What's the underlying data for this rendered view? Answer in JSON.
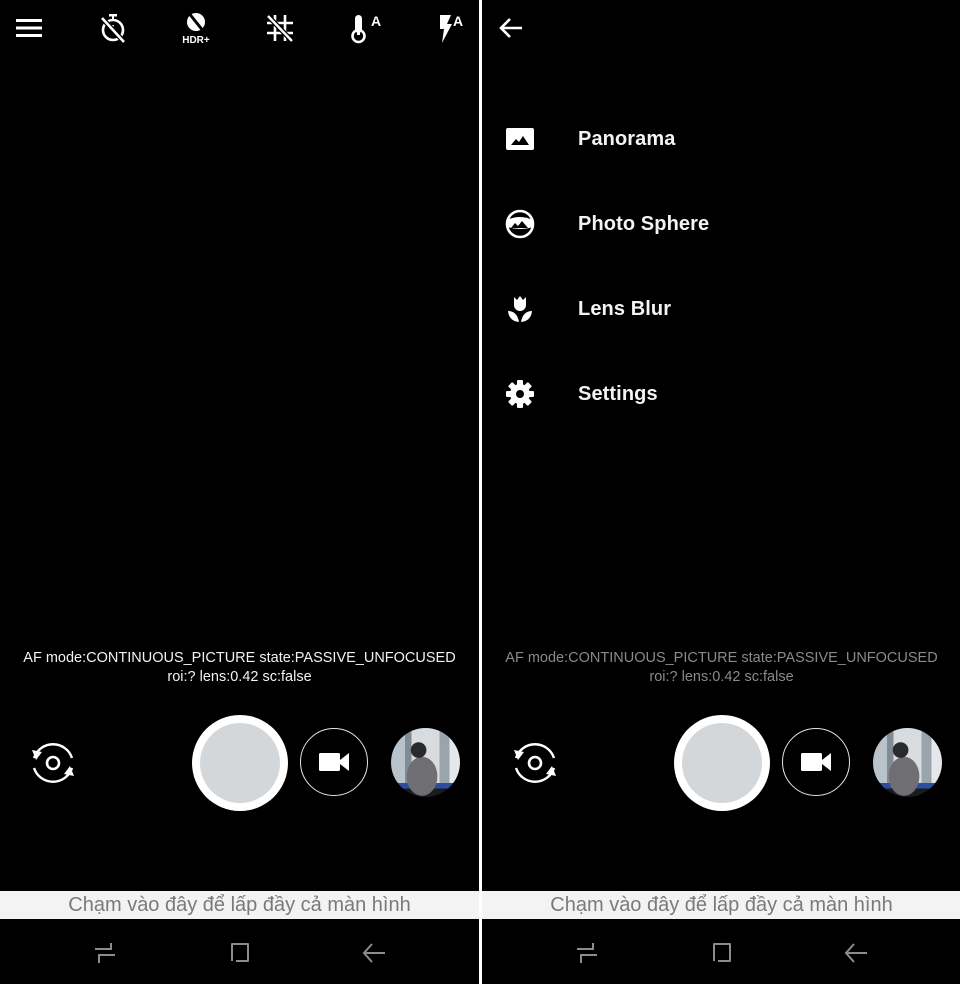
{
  "left_screen": {
    "toolbar": {
      "icons": [
        {
          "name": "menu-icon",
          "label": "Menu"
        },
        {
          "name": "timer-off-icon",
          "label": "Timer off"
        },
        {
          "name": "hdr-plus-icon",
          "label": "HDR+",
          "text": "HDR+"
        },
        {
          "name": "grid-off-icon",
          "label": "Grid off"
        },
        {
          "name": "white-balance-auto-icon",
          "label": "White balance auto",
          "text": "A"
        },
        {
          "name": "flash-auto-icon",
          "label": "Flash auto",
          "text": "A"
        }
      ]
    },
    "af_debug": {
      "line1": "AF mode:CONTINUOUS_PICTURE state:PASSIVE_UNFOCUSED",
      "line2": "roi:? lens:0.42 sc:false"
    }
  },
  "right_screen": {
    "back_label": "Back",
    "menu": {
      "items": [
        {
          "icon": "panorama-icon",
          "label": "Panorama"
        },
        {
          "icon": "photo-sphere-icon",
          "label": "Photo Sphere"
        },
        {
          "icon": "lens-blur-icon",
          "label": "Lens Blur"
        },
        {
          "icon": "settings-icon",
          "label": "Settings"
        }
      ]
    },
    "af_debug": {
      "line1": "AF mode:CONTINUOUS_PICTURE state:PASSIVE_UNFOCUSED",
      "line2": "roi:? lens:0.42 sc:false"
    }
  },
  "controls": {
    "switch_camera": "Switch camera",
    "shutter": "Shutter",
    "video": "Video",
    "thumbnail": "Last photo"
  },
  "banner": {
    "text": "Chạm vào đây để lấp đầy cả màn hình"
  },
  "navbar": {
    "recent": "Recent apps",
    "home": "Home",
    "back": "Back"
  },
  "colors": {
    "background": "#000000",
    "shutter_fill": "#d3d7da",
    "banner_bg": "#f3f3f3",
    "banner_text": "#7a7a7a",
    "nav_icon": "#8c8c8c"
  }
}
